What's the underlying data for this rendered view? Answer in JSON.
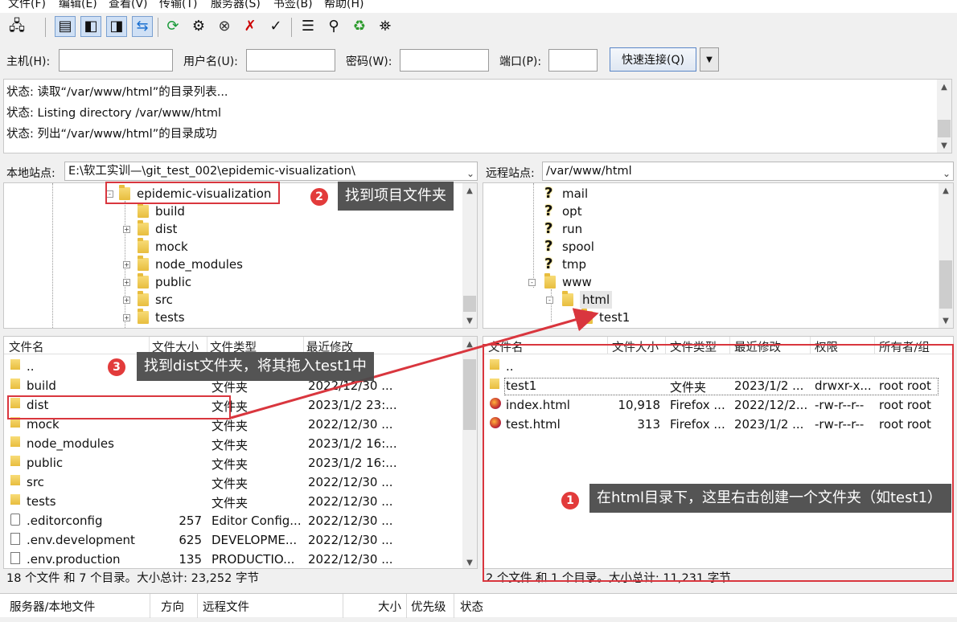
{
  "menu": [
    "文件(F)",
    "编辑(E)",
    "查看(V)",
    "传输(T)",
    "服务器(S)",
    "书签(B)",
    "帮助(H)"
  ],
  "toolbar_icons": [
    "site-manager-icon",
    "toggle-log-icon",
    "toggle-local-tree-icon",
    "toggle-remote-tree-icon",
    "toggle-queue-icon",
    "refresh-icon",
    "process-queue-icon",
    "cancel-icon",
    "disconnect-icon",
    "reconnect-icon",
    "directory-filter-icon",
    "compare-icon",
    "sync-browse-icon",
    "search-icon"
  ],
  "quickconnect": {
    "host_label": "主机(H):",
    "user_label": "用户名(U):",
    "pass_label": "密码(W):",
    "port_label": "端口(P):",
    "button": "快速连接(Q)"
  },
  "log": [
    "状态:  读取“/var/www/html”的目录列表...",
    "状态:  Listing directory /var/www/html",
    "状态:  列出“/var/www/html”的目录成功"
  ],
  "local": {
    "site_label": "本地站点:",
    "path": "E:\\软工实训—\\git_test_002\\epidemic-visualization\\",
    "tree": [
      {
        "name": "epidemic-visualization",
        "expand": "-"
      },
      {
        "name": "build",
        "expand": ""
      },
      {
        "name": "dist",
        "expand": "+"
      },
      {
        "name": "mock",
        "expand": ""
      },
      {
        "name": "node_modules",
        "expand": "+"
      },
      {
        "name": "public",
        "expand": "+"
      },
      {
        "name": "src",
        "expand": "+"
      },
      {
        "name": "tests",
        "expand": "+"
      }
    ],
    "columns": [
      "文件名",
      "文件大小",
      "文件类型",
      "最近修改"
    ],
    "files": [
      {
        "name": "..",
        "size": "",
        "type": "",
        "modified": "",
        "icon": "folder"
      },
      {
        "name": "build",
        "size": "",
        "type": "文件夹",
        "modified": "2022/12/30 ...",
        "icon": "folder"
      },
      {
        "name": "dist",
        "size": "",
        "type": "文件夹",
        "modified": "2023/1/2 23:...",
        "icon": "folder"
      },
      {
        "name": "mock",
        "size": "",
        "type": "文件夹",
        "modified": "2022/12/30 ...",
        "icon": "folder"
      },
      {
        "name": "node_modules",
        "size": "",
        "type": "文件夹",
        "modified": "2023/1/2 16:...",
        "icon": "folder"
      },
      {
        "name": "public",
        "size": "",
        "type": "文件夹",
        "modified": "2023/1/2 16:...",
        "icon": "folder"
      },
      {
        "name": "src",
        "size": "",
        "type": "文件夹",
        "modified": "2022/12/30 ...",
        "icon": "folder"
      },
      {
        "name": "tests",
        "size": "",
        "type": "文件夹",
        "modified": "2022/12/30 ...",
        "icon": "folder"
      },
      {
        "name": ".editorconfig",
        "size": "257",
        "type": "Editor Config...",
        "modified": "2022/12/30 ...",
        "icon": "cfg"
      },
      {
        "name": ".env.development",
        "size": "625",
        "type": "DEVELOPME...",
        "modified": "2022/12/30 ...",
        "icon": "file"
      },
      {
        "name": ".env.production",
        "size": "135",
        "type": "PRODUCTIO...",
        "modified": "2022/12/30 ...",
        "icon": "file"
      }
    ],
    "status": "18 个文件 和 7 个目录。大小总计: 23,252 字节"
  },
  "remote": {
    "site_label": "远程站点:",
    "path": "/var/www/html",
    "tree": [
      {
        "name": "mail",
        "icon": "unknown"
      },
      {
        "name": "opt",
        "icon": "unknown"
      },
      {
        "name": "run",
        "icon": "unknown"
      },
      {
        "name": "spool",
        "icon": "unknown"
      },
      {
        "name": "tmp",
        "icon": "unknown"
      },
      {
        "name": "www",
        "icon": "folder",
        "expand": "-"
      },
      {
        "name": "html",
        "icon": "folder",
        "expand": "-"
      },
      {
        "name": "test1",
        "icon": "folder"
      }
    ],
    "columns": [
      "文件名",
      "文件大小",
      "文件类型",
      "最近修改",
      "权限",
      "所有者/组"
    ],
    "files": [
      {
        "name": "..",
        "size": "",
        "type": "",
        "modified": "",
        "perm": "",
        "owner": "",
        "icon": "folder"
      },
      {
        "name": "test1",
        "size": "",
        "type": "文件夹",
        "modified": "2023/1/2 ...",
        "perm": "drwxr-x...",
        "owner": "root root",
        "icon": "folder"
      },
      {
        "name": "index.html",
        "size": "10,918",
        "type": "Firefox ...",
        "modified": "2022/12/2...",
        "perm": "-rw-r--r--",
        "owner": "root root",
        "icon": "ff"
      },
      {
        "name": "test.html",
        "size": "313",
        "type": "Firefox ...",
        "modified": "2023/1/2 ...",
        "perm": "-rw-r--r--",
        "owner": "root root",
        "icon": "ff"
      }
    ],
    "status": "2 个文件 和 1 个目录。大小总计: 11,231 字节"
  },
  "queue_columns": [
    "服务器/本地文件",
    "方向",
    "远程文件",
    "大小",
    "优先级",
    "状态"
  ],
  "annotations": {
    "a1": {
      "num": "1",
      "text": "在html目录下，这里右击创建一个文件夹（如test1）"
    },
    "a2": {
      "num": "2",
      "text": "找到项目文件夹"
    },
    "a3": {
      "num": "3",
      "text": "找到dist文件夹，将其拖入test1中"
    }
  },
  "colors": {
    "annotation_red": "#d9363e",
    "callout_bg": "#4b4b4b"
  }
}
